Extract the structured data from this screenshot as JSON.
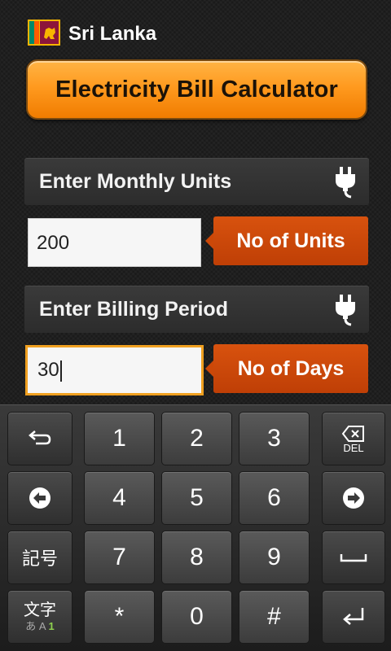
{
  "header": {
    "title": "Sri Lanka"
  },
  "banner": {
    "title": "Electricity Bill Calculator"
  },
  "units_section": {
    "label": "Enter Monthly Units",
    "value": "200",
    "tag": "No of Units"
  },
  "period_section": {
    "label": "Enter Billing Period",
    "value": "30",
    "tag": "No of Days"
  },
  "keyboard": {
    "keys": {
      "k1": "1",
      "k2": "2",
      "k3": "3",
      "k4": "4",
      "k5": "5",
      "k6": "6",
      "k7": "7",
      "k8": "8",
      "k9": "9",
      "star": "*",
      "k0": "0",
      "hash": "#",
      "symbols": "記号",
      "mode_top": "文字",
      "mode_bottom_a": "あ",
      "mode_bottom_b": "A",
      "mode_bottom_c": "1",
      "del_label": "DEL"
    }
  },
  "colors": {
    "accent_orange": "#ff9a1f",
    "tag_orange": "#d8520e",
    "focus_border": "#f0a020"
  }
}
